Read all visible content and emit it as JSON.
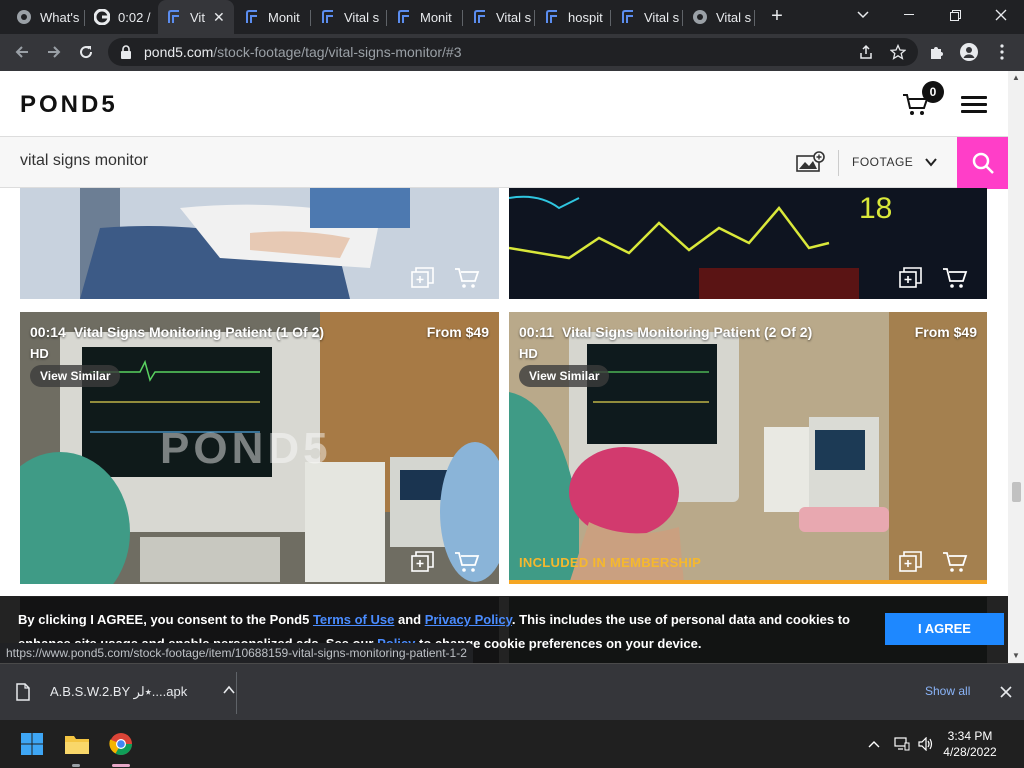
{
  "browser": {
    "tabs": [
      {
        "title": "What's",
        "icon": "chrome-icon"
      },
      {
        "title": "0:02 /",
        "icon": "google-icon"
      },
      {
        "title": "Vit",
        "icon": "pond5-icon",
        "active": true
      },
      {
        "title": "Monit",
        "icon": "pond5-icon"
      },
      {
        "title": "Vital s",
        "icon": "pond5-icon"
      },
      {
        "title": "Monit",
        "icon": "pond5-icon"
      },
      {
        "title": "Vital s",
        "icon": "pond5-icon"
      },
      {
        "title": "hospit",
        "icon": "pond5-icon"
      },
      {
        "title": "Vital s",
        "icon": "pond5-icon"
      },
      {
        "title": "Vital s",
        "icon": "chrome-icon"
      }
    ],
    "url_host": "pond5.com",
    "url_path": "/stock-footage/tag/vital-signs-monitor/#3",
    "status_url": "https://www.pond5.com/stock-footage/item/10688159-vital-signs-monitoring-patient-1-2"
  },
  "site": {
    "logo": "POND5",
    "cart_count": "0",
    "search_value": "vital signs monitor",
    "media_type": "FOOTAGE",
    "accent_color": "#ff3ec8"
  },
  "results": [
    {
      "duration": "00:14",
      "title": "Vital Signs Monitoring Patient (1 Of 2)",
      "quality": "HD",
      "price": "From $49",
      "similar_label": "View Similar",
      "watermark": "POND5"
    },
    {
      "duration": "00:11",
      "title": "Vital Signs Monitoring Patient (2 Of 2)",
      "quality": "HD",
      "price": "From $49",
      "similar_label": "View Similar",
      "membership_label": "INCLUDED IN MEMBERSHIP"
    }
  ],
  "cookie": {
    "text_1": "By clicking I AGREE, you consent to the Pond5 ",
    "terms": "Terms of Use",
    "and": " and ",
    "privacy": "Privacy Policy",
    "text_2": ". This includes the use of personal data and cookies to enhance site usage and enable personalized ads. See our ",
    "policy": "Policy",
    "text_3": " to change cookie preferences on your device.",
    "agree": "I AGREE"
  },
  "downloads": {
    "file_name": "A.B.S.W.2.BY ٭لر....apk",
    "show_all": "Show all"
  },
  "taskbar": {
    "time": "3:34 PM",
    "date": "4/28/2022"
  }
}
